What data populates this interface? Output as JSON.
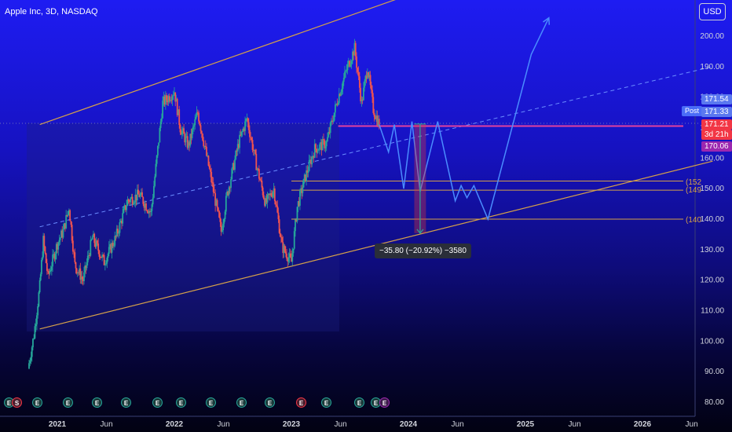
{
  "title": "Apple Inc, 3D, NASDAQ",
  "currency_button": "USD",
  "price_scale": [
    "200.00",
    "190.00",
    "180.00",
    "170.00",
    "160.00",
    "150.00",
    "140.00",
    "130.00",
    "120.00",
    "110.00",
    "100.00",
    "90.00",
    "80.00"
  ],
  "time_scale": [
    "2021",
    "Jun",
    "2022",
    "Jun",
    "2023",
    "Jun",
    "2024",
    "Jun",
    "2025",
    "Jun",
    "2026",
    "Jun"
  ],
  "price_tags": {
    "t1": "171.54",
    "t2": "171.33",
    "post": "Post",
    "t3": "171.21",
    "t4": "3d 21h",
    "t5": "170.06"
  },
  "level_labels": [
    "(152",
    "(149",
    "(140"
  ],
  "measure_text": "−35.80 (−20.92%) −3580",
  "events": [
    {
      "glyph": "E",
      "color": "#26a69a"
    },
    {
      "glyph": "S",
      "color": "#f23645"
    },
    {
      "glyph": "E",
      "color": "#26a69a"
    },
    {
      "glyph": "E",
      "color": "#26a69a"
    },
    {
      "glyph": "E",
      "color": "#26a69a"
    },
    {
      "glyph": "E",
      "color": "#26a69a"
    },
    {
      "glyph": "E",
      "color": "#26a69a"
    },
    {
      "glyph": "E",
      "color": "#26a69a"
    },
    {
      "glyph": "E",
      "color": "#26a69a"
    },
    {
      "glyph": "E",
      "color": "#26a69a"
    },
    {
      "glyph": "E",
      "color": "#26a69a"
    },
    {
      "glyph": "E",
      "color": "#f23645"
    },
    {
      "glyph": "E",
      "color": "#26a69a"
    },
    {
      "glyph": "E",
      "color": "#26a69a"
    },
    {
      "glyph": "E",
      "color": "#26a69a"
    },
    {
      "glyph": "E",
      "color": "#9c27b0"
    }
  ],
  "chart_data": {
    "type": "candlestick",
    "symbol": "Apple Inc",
    "interval": "3D",
    "exchange": "NASDAQ",
    "currency": "USD",
    "ylim": [
      78,
      206
    ],
    "colors": {
      "up": "#26a69a",
      "down": "#ef5350",
      "channel": "#d4a04a",
      "midline": "#6a8cff",
      "projection": "#4a8cff",
      "resistance": "#e040a0",
      "levels": "#d4a04a"
    },
    "price_path": [
      [
        2020.75,
        91
      ],
      [
        2020.8,
        102
      ],
      [
        2020.85,
        118
      ],
      [
        2020.88,
        133
      ],
      [
        2020.92,
        121
      ],
      [
        2021.0,
        132
      ],
      [
        2021.05,
        136
      ],
      [
        2021.1,
        144
      ],
      [
        2021.15,
        125
      ],
      [
        2021.22,
        120
      ],
      [
        2021.3,
        134
      ],
      [
        2021.4,
        126
      ],
      [
        2021.5,
        134
      ],
      [
        2021.6,
        146
      ],
      [
        2021.7,
        148
      ],
      [
        2021.8,
        142
      ],
      [
        2021.9,
        178
      ],
      [
        2022.0,
        182
      ],
      [
        2022.05,
        170
      ],
      [
        2022.12,
        164
      ],
      [
        2022.2,
        175
      ],
      [
        2022.3,
        156
      ],
      [
        2022.4,
        136
      ],
      [
        2022.45,
        148
      ],
      [
        2022.55,
        165
      ],
      [
        2022.62,
        173
      ],
      [
        2022.7,
        158
      ],
      [
        2022.78,
        145
      ],
      [
        2022.85,
        150
      ],
      [
        2022.92,
        131
      ],
      [
        2023.0,
        126
      ],
      [
        2023.05,
        144
      ],
      [
        2023.12,
        154
      ],
      [
        2023.2,
        163
      ],
      [
        2023.3,
        165
      ],
      [
        2023.4,
        180
      ],
      [
        2023.48,
        190
      ],
      [
        2023.54,
        196
      ],
      [
        2023.6,
        178
      ],
      [
        2023.65,
        190
      ],
      [
        2023.7,
        176
      ],
      [
        2023.75,
        171
      ]
    ],
    "projection_path": [
      [
        2023.75,
        171
      ],
      [
        2023.83,
        162
      ],
      [
        2023.88,
        171
      ],
      [
        2023.96,
        150
      ],
      [
        2024.03,
        172
      ],
      [
        2024.1,
        149
      ],
      [
        2024.25,
        172
      ],
      [
        2024.4,
        146
      ],
      [
        2024.45,
        151
      ],
      [
        2024.5,
        147
      ],
      [
        2024.56,
        151
      ],
      [
        2024.68,
        140
      ],
      [
        2025.05,
        194
      ],
      [
        2025.2,
        206
      ]
    ],
    "channel": {
      "upper": [
        [
          2020.85,
          171
        ],
        [
          2025.3,
          231
        ]
      ],
      "lower": [
        [
          2020.85,
          104
        ],
        [
          2026.6,
          159
        ]
      ],
      "mid": [
        [
          2020.85,
          137.5
        ],
        [
          2026.6,
          190
        ]
      ]
    },
    "horizontal_levels": [
      {
        "from": 2023.4,
        "to": 2026.45,
        "price": 170.5,
        "kind": "resistance"
      },
      {
        "from": 2023.0,
        "to": 2026.45,
        "price": 152.5
      },
      {
        "from": 2023.0,
        "to": 2026.45,
        "price": 149.5
      },
      {
        "from": 2023.0,
        "to": 2026.45,
        "price": 140.0
      }
    ],
    "measure": {
      "from_x": 2024.05,
      "to_x": 2024.15,
      "from_price": 171.2,
      "to_price": 135.4,
      "change": -35.8,
      "change_pct": -20.92,
      "ticks": -3580
    },
    "last_prices": {
      "high_tag": 171.54,
      "post_tag": 171.33,
      "close": 171.21,
      "countdown": "3d 21h",
      "ma": 170.06
    }
  }
}
